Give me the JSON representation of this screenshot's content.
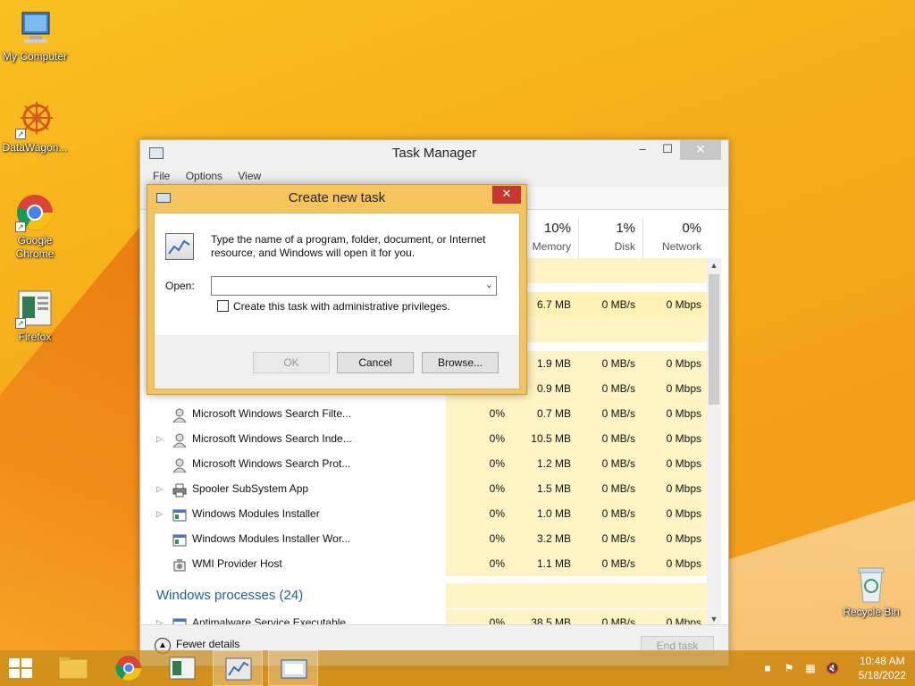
{
  "desktop": {
    "icons": [
      {
        "label": "My Computer"
      },
      {
        "label": "DataWagon..."
      },
      {
        "label": "Google Chrome"
      },
      {
        "label": "Firefox"
      },
      {
        "label": "Recycle Bin"
      }
    ]
  },
  "task_manager": {
    "title": "Task Manager",
    "menu": [
      "File",
      "Options",
      "View"
    ],
    "columns": [
      {
        "pct": "10%",
        "label": "Memory"
      },
      {
        "pct": "1%",
        "label": "Disk"
      },
      {
        "pct": "0%",
        "label": "Network"
      }
    ],
    "rows": [
      {
        "name": "",
        "cpu": "",
        "mem": "6.7 MB",
        "disk": "0 MB/s",
        "net": "0 Mbps"
      },
      {
        "name": "",
        "cpu": "",
        "mem": "1.9 MB",
        "disk": "0 MB/s",
        "net": "0 Mbps"
      },
      {
        "name": "",
        "cpu": "",
        "mem": "0.9 MB",
        "disk": "0 MB/s",
        "net": "0 Mbps"
      },
      {
        "name": "Microsoft Windows Search Filte...",
        "cpu": "0%",
        "mem": "0.7 MB",
        "disk": "0 MB/s",
        "net": "0 Mbps"
      },
      {
        "name": "Microsoft Windows Search Inde...",
        "cpu": "0%",
        "mem": "10.5 MB",
        "disk": "0 MB/s",
        "net": "0 Mbps"
      },
      {
        "name": "Microsoft Windows Search Prot...",
        "cpu": "0%",
        "mem": "1.2 MB",
        "disk": "0 MB/s",
        "net": "0 Mbps"
      },
      {
        "name": "Spooler SubSystem App",
        "cpu": "0%",
        "mem": "1.5 MB",
        "disk": "0 MB/s",
        "net": "0 Mbps"
      },
      {
        "name": "Windows Modules Installer",
        "cpu": "0%",
        "mem": "1.0 MB",
        "disk": "0 MB/s",
        "net": "0 Mbps"
      },
      {
        "name": "Windows Modules Installer Wor...",
        "cpu": "0%",
        "mem": "3.2 MB",
        "disk": "0 MB/s",
        "net": "0 Mbps"
      },
      {
        "name": "WMI Provider Host",
        "cpu": "0%",
        "mem": "1.1 MB",
        "disk": "0 MB/s",
        "net": "0 Mbps"
      }
    ],
    "group_title": "Windows processes (24)",
    "last_row": {
      "name": "Antimalware Service Executable",
      "cpu": "0%",
      "mem": "38.5 MB",
      "disk": "0 MB/s",
      "net": "0 Mbps"
    },
    "fewer_details": "Fewer details",
    "end_task": "End task"
  },
  "dialog": {
    "title": "Create new task",
    "message": "Type the name of a program, folder, document, or Internet resource, and Windows will open it for you.",
    "open_label": "Open:",
    "open_value": "",
    "admin_label": "Create this task with administrative privileges.",
    "ok": "OK",
    "cancel": "Cancel",
    "browse": "Browse..."
  },
  "taskbar": {
    "time": "10:48 AM",
    "date": "5/18/2022"
  }
}
